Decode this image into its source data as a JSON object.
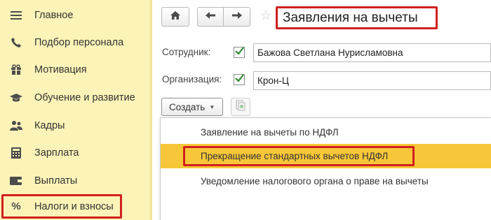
{
  "sidebar": {
    "items": [
      {
        "label": "Главное",
        "icon": "menu-lines-icon"
      },
      {
        "label": "Подбор персонала",
        "icon": "phone-icon"
      },
      {
        "label": "Мотивация",
        "icon": "gift-icon"
      },
      {
        "label": "Обучение и развитие",
        "icon": "graduation-cap-icon"
      },
      {
        "label": "Кадры",
        "icon": "people-icon"
      },
      {
        "label": "Зарплата",
        "icon": "calculator-icon"
      },
      {
        "label": "Выплаты",
        "icon": "wallet-icon"
      },
      {
        "label": "Налоги и взносы",
        "icon": "percent-icon"
      }
    ],
    "active_index": 7
  },
  "header": {
    "title": "Заявления на вычеты"
  },
  "form": {
    "employee_label": "Сотрудник:",
    "employee_value": "Бажова Светлана Нурисламовна",
    "employee_checked": true,
    "org_label": "Организация:",
    "org_value": "Крон-Ц",
    "org_checked": true,
    "create_label": "Создать"
  },
  "menu": {
    "items": [
      "Заявление на вычеты по НДФЛ",
      "Прекращение стандартных вычетов НДФЛ",
      "Уведомление налогового органа о праве на вычеты"
    ],
    "highlighted_index": 1
  },
  "colors": {
    "sidebar_bg": "#fbf3b7",
    "highlight": "#f8c739",
    "annotation_red": "#d01f1f",
    "check_green": "#2e8b2e"
  }
}
